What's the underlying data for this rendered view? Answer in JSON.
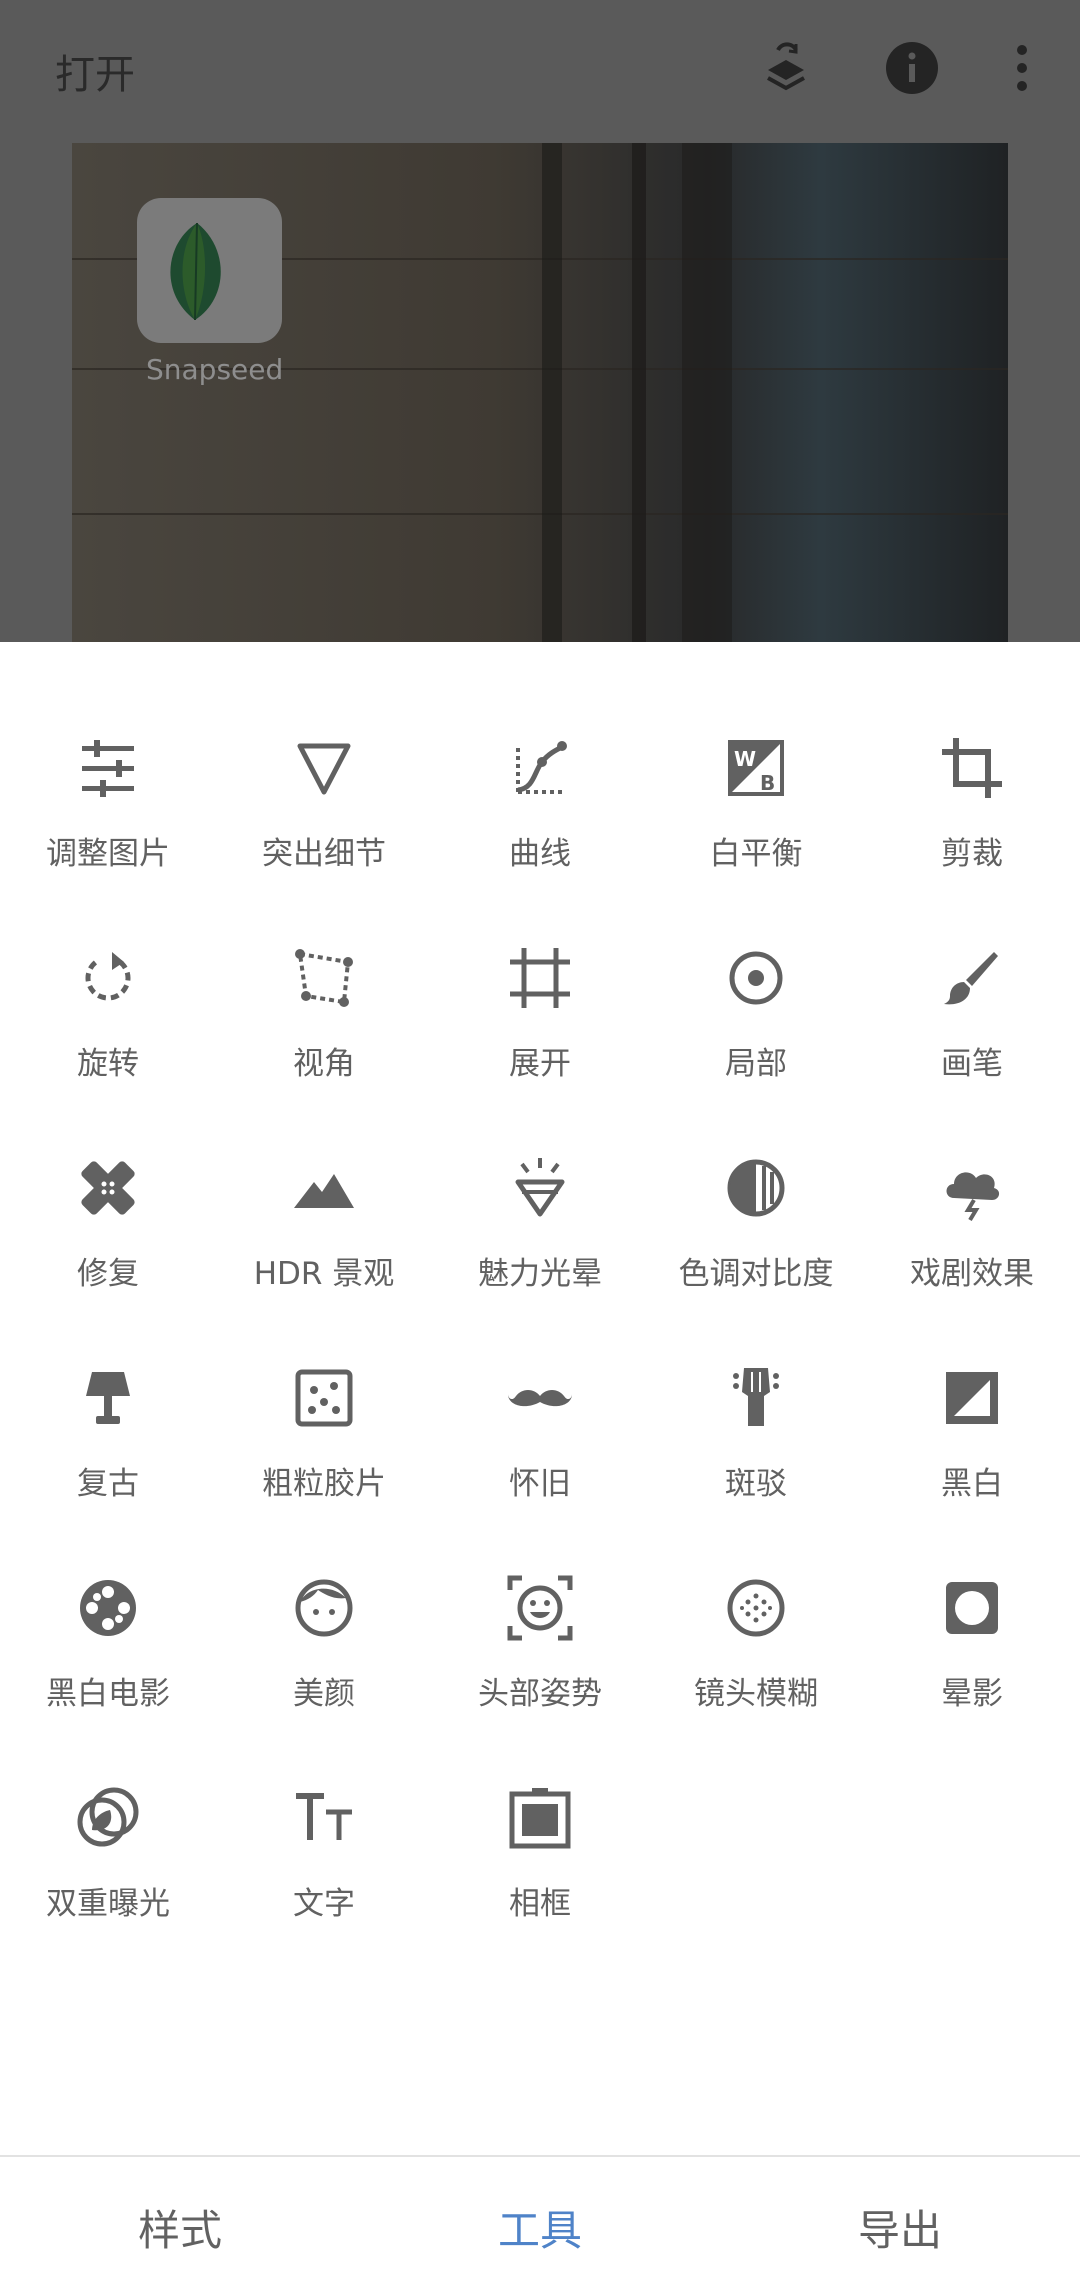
{
  "header": {
    "title": "打开",
    "icons": [
      "layers-swap-icon",
      "info-icon",
      "more-vert-icon"
    ]
  },
  "preview": {
    "app_label": "Snapseed"
  },
  "tools": [
    {
      "label": "调整图片",
      "icon": "tune-sliders-icon"
    },
    {
      "label": "突出细节",
      "icon": "details-triangle-icon"
    },
    {
      "label": "曲线",
      "icon": "curves-icon"
    },
    {
      "label": "白平衡",
      "icon": "white-balance-icon"
    },
    {
      "label": "剪裁",
      "icon": "crop-icon"
    },
    {
      "label": "旋转",
      "icon": "rotate-icon"
    },
    {
      "label": "视角",
      "icon": "perspective-icon"
    },
    {
      "label": "展开",
      "icon": "expand-icon"
    },
    {
      "label": "局部",
      "icon": "selective-target-icon"
    },
    {
      "label": "画笔",
      "icon": "brush-icon"
    },
    {
      "label": "修复",
      "icon": "healing-bandage-icon"
    },
    {
      "label": "HDR 景观",
      "icon": "mountains-icon"
    },
    {
      "label": "魅力光晕",
      "icon": "glamour-glow-icon"
    },
    {
      "label": "色调对比度",
      "icon": "tonal-contrast-icon"
    },
    {
      "label": "戏剧效果",
      "icon": "drama-cloud-icon"
    },
    {
      "label": "复古",
      "icon": "vintage-lamp-icon"
    },
    {
      "label": "粗粒胶片",
      "icon": "grainy-film-dice-icon"
    },
    {
      "label": "怀旧",
      "icon": "mustache-icon"
    },
    {
      "label": "斑驳",
      "icon": "grunge-guitar-icon"
    },
    {
      "label": "黑白",
      "icon": "black-white-icon"
    },
    {
      "label": "黑白电影",
      "icon": "film-reel-icon"
    },
    {
      "label": "美颜",
      "icon": "face-icon"
    },
    {
      "label": "头部姿势",
      "icon": "head-pose-icon"
    },
    {
      "label": "镜头模糊",
      "icon": "lens-blur-icon"
    },
    {
      "label": "晕影",
      "icon": "vignette-icon"
    },
    {
      "label": "双重曝光",
      "icon": "double-exposure-icon"
    },
    {
      "label": "文字",
      "icon": "text-icon"
    },
    {
      "label": "相框",
      "icon": "frame-icon"
    }
  ],
  "bottom_tabs": [
    {
      "label": "样式",
      "active": false
    },
    {
      "label": "工具",
      "active": true
    },
    {
      "label": "导出",
      "active": false
    }
  ],
  "colors": {
    "dim_overlay": "#5a5a5a",
    "icon": "#616161",
    "active_tab": "#4f83c8"
  }
}
